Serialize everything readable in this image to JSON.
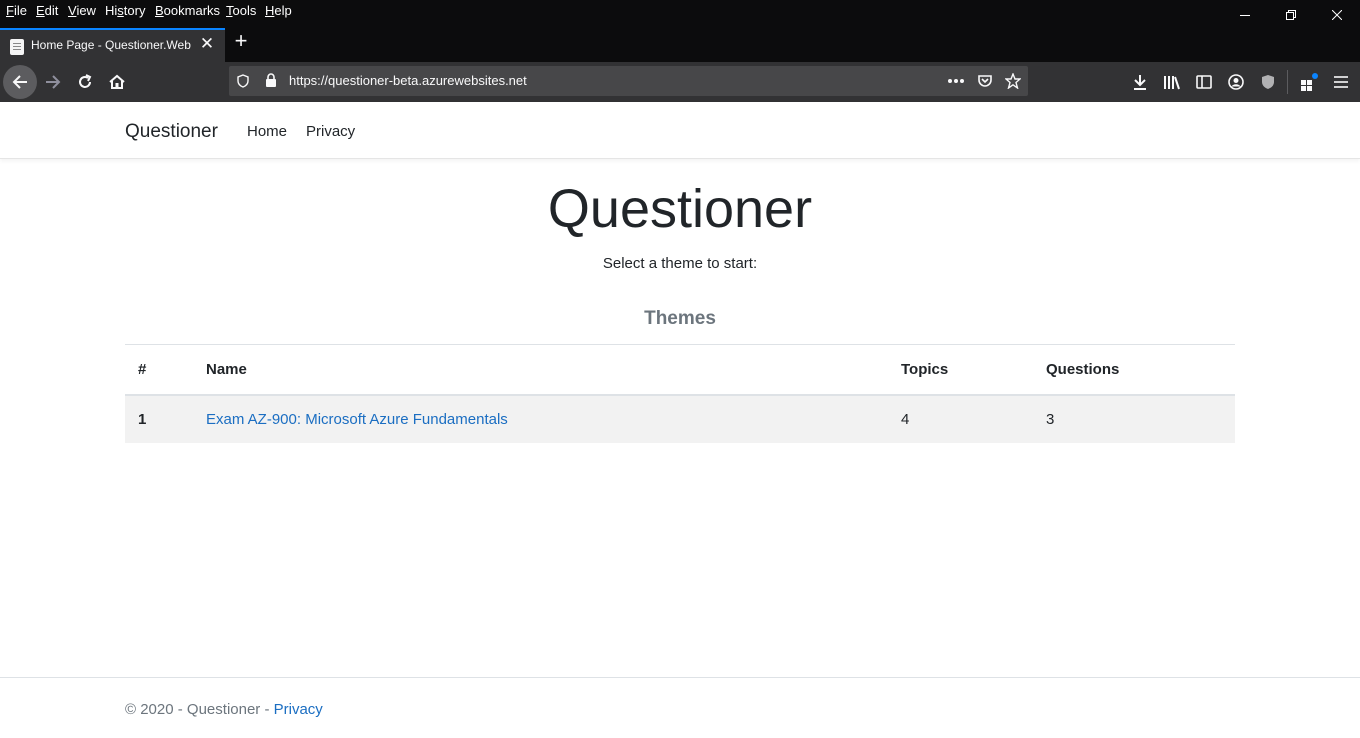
{
  "menubar": {
    "items": [
      {
        "pre": "",
        "acc": "F",
        "post": "ile"
      },
      {
        "pre": "",
        "acc": "E",
        "post": "dit"
      },
      {
        "pre": "",
        "acc": "V",
        "post": "iew"
      },
      {
        "pre": "Hi",
        "acc": "s",
        "post": "tory"
      },
      {
        "pre": "",
        "acc": "B",
        "post": "ookmarks"
      },
      {
        "pre": "",
        "acc": "T",
        "post": "ools"
      },
      {
        "pre": "",
        "acc": "H",
        "post": "elp"
      }
    ]
  },
  "browser": {
    "tab_title": "Home Page - Questioner.Web",
    "tab_close": "✕",
    "new_tab": "+",
    "url": "https://questioner-beta.azurewebsites.net",
    "accent_color": "#0a84ff"
  },
  "site": {
    "brand": "Questioner",
    "nav": [
      {
        "label": "Home"
      },
      {
        "label": "Privacy"
      }
    ],
    "hero_title": "Questioner",
    "hero_subtitle": "Select a theme to start:",
    "themes_heading": "Themes",
    "link_color": "#1b6ec2"
  },
  "themes_table": {
    "headers": {
      "num": "#",
      "name": "Name",
      "topics": "Topics",
      "questions": "Questions"
    },
    "rows": [
      {
        "num": "1",
        "name": "Exam AZ-900: Microsoft Azure Fundamentals",
        "topics": "4",
        "questions": "3"
      }
    ]
  },
  "footer": {
    "text": "© 2020 - Questioner - ",
    "privacy_link": "Privacy"
  }
}
